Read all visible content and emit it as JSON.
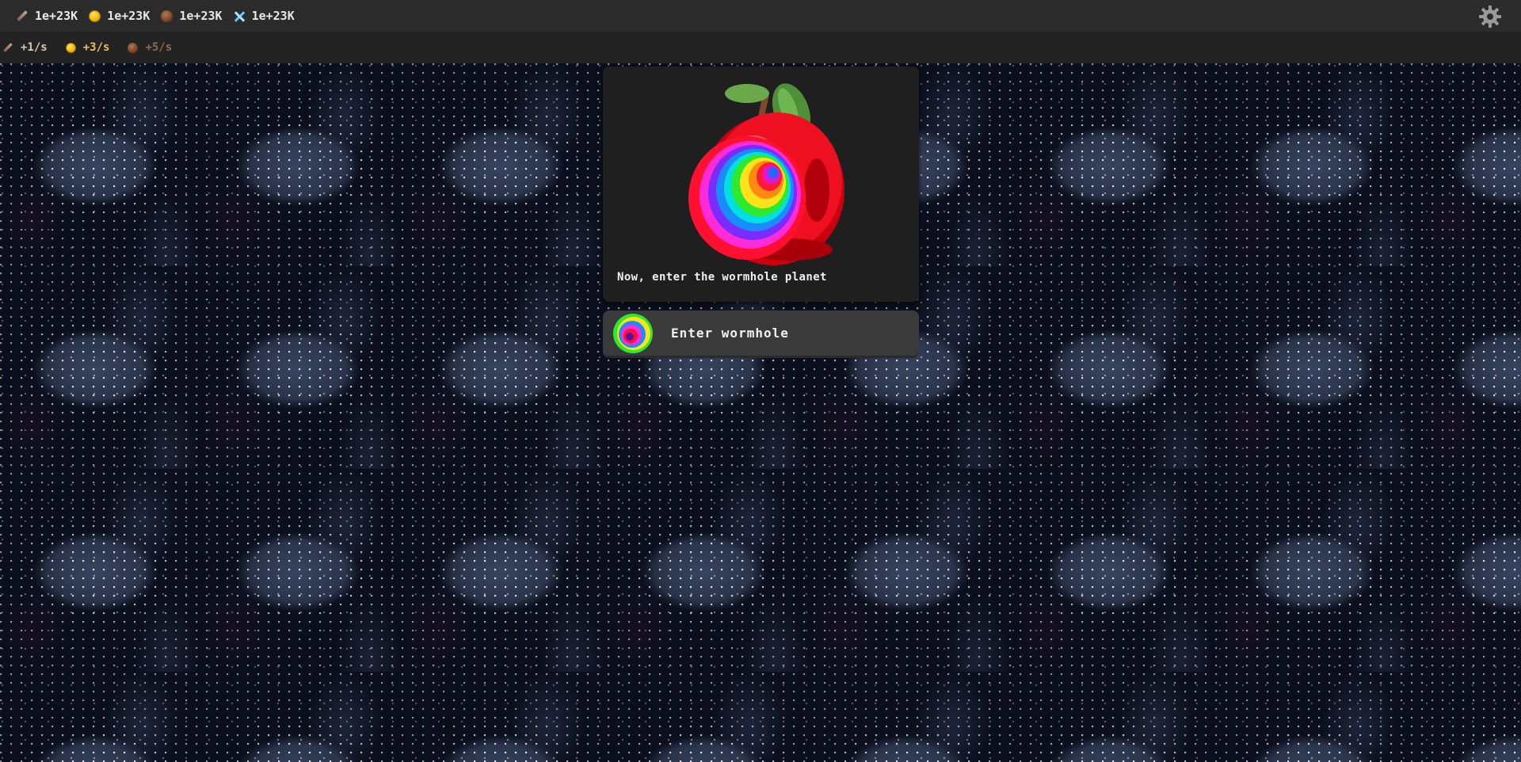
{
  "resources": [
    {
      "icon": "stick-icon",
      "value": "1e+23K"
    },
    {
      "icon": "coin-icon",
      "value": "1e+23K"
    },
    {
      "icon": "nut-icon",
      "value": "1e+23K"
    },
    {
      "icon": "crystal-icon",
      "value": "1e+23K"
    }
  ],
  "rates": [
    {
      "icon": "stick-icon",
      "value": "+1/s"
    },
    {
      "icon": "coin-icon",
      "value": "+3/s"
    },
    {
      "icon": "nut-icon",
      "value": "+5/s"
    }
  ],
  "settings": {
    "icon": "gear-icon"
  },
  "panel": {
    "image": "wormhole-apple-image",
    "message": "Now, enter the wormhole planet"
  },
  "action": {
    "icon": "wormhole-icon",
    "label": "Enter wormhole"
  },
  "colors": {
    "topbar": "#2b2b2b",
    "ratebar": "#232323",
    "panel": "#1f1f1f",
    "button": "#3a3a3a",
    "background": "#0c1120"
  }
}
